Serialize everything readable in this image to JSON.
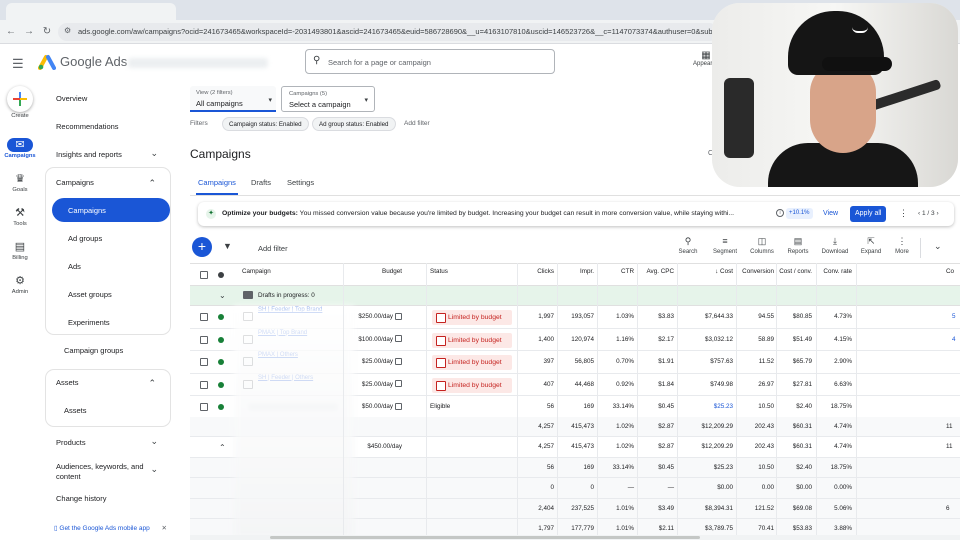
{
  "browser": {
    "url": "ads.google.com/aw/campaigns?ocid=241673465&workspaceId=-2031493801&ascid=241673465&euid=586728690&__u=4163107810&uscid=146523726&__c=1147073374&authuser=0&subid="
  },
  "header": {
    "brand": "Google Ads",
    "search_placeholder": "Search for a page or campaign",
    "appearance_label": "Appearan"
  },
  "rail": {
    "create": "Create",
    "campaigns": "Campaigns",
    "goals": "Goals",
    "tools": "Tools",
    "billing": "Billing",
    "admin": "Admin"
  },
  "nav": {
    "overview": "Overview",
    "recommendations": "Recommendations",
    "insights": "Insights and reports",
    "campaigns_group": "Campaigns",
    "campaigns_sub": [
      "Campaigns",
      "Ad groups",
      "Ads",
      "Asset groups",
      "Experiments",
      "Campaign groups"
    ],
    "assets_group": "Assets",
    "assets_sub": "Assets",
    "products": "Products",
    "audiences": "Audiences, keywords, and content",
    "change_history": "Change history",
    "mobile_app": "Get the Google Ads mobile app"
  },
  "selectors": {
    "view_caption": "View (2 filters)",
    "view_value": "All campaigns",
    "campaigns_caption": "Campaigns (5)",
    "campaigns_value": "Select a campaign"
  },
  "filters": {
    "label": "Filters",
    "chips": [
      "Campaign status: Enabled",
      "Ad group status: Enabled"
    ],
    "add": "Add filter"
  },
  "page": {
    "title": "Campaigns",
    "cu": "Cu",
    "tabs": [
      "Campaigns",
      "Drafts",
      "Settings"
    ]
  },
  "banner": {
    "bold": "Optimize your budgets:",
    "text": " You missed conversion value because you're limited by budget. Increasing your budget can result in more conversion value, while staying withi...",
    "pct": "+10.1%",
    "view": "View",
    "apply": "Apply all",
    "pager": "1 / 3"
  },
  "toolbar": {
    "add_filter": "Add filter",
    "tools": [
      "Search",
      "Segment",
      "Columns",
      "Reports",
      "Download",
      "Expand",
      "More"
    ]
  },
  "table": {
    "headers": [
      "Campaign",
      "Budget",
      "Status",
      "Clicks",
      "Impr.",
      "CTR",
      "Avg. CPC",
      "Cost",
      "Conversion",
      "Cost / conv.",
      "Conv. rate",
      "Co"
    ],
    "drafts": "Drafts in progress: 0",
    "rows": [
      {
        "name": "SH | Feeder | Top Brand",
        "budget": "$250.00/day",
        "status": "Limited by budget",
        "clicks": "1,997",
        "impr": "193,057",
        "ctr": "1.03%",
        "cpc": "$3.83",
        "cost": "$7,644.33",
        "conv": "94.55",
        "costconv": "$80.85",
        "convrate": "4.73%",
        "co": "5"
      },
      {
        "name": "PMAX | Top Brand",
        "budget": "$100.00/day",
        "status": "Limited by budget",
        "clicks": "1,400",
        "impr": "120,974",
        "ctr": "1.16%",
        "cpc": "$2.17",
        "cost": "$3,032.12",
        "conv": "58.89",
        "costconv": "$51.49",
        "convrate": "4.15%",
        "co": "4"
      },
      {
        "name": "PMAX | Others",
        "budget": "$25.00/day",
        "status": "Limited by budget",
        "clicks": "397",
        "impr": "56,805",
        "ctr": "0.70%",
        "cpc": "$1.91",
        "cost": "$757.63",
        "conv": "11.52",
        "costconv": "$65.79",
        "convrate": "2.90%",
        "co": ""
      },
      {
        "name": "SH | Feeder | Others",
        "budget": "$25.00/day",
        "status": "Limited by budget",
        "clicks": "407",
        "impr": "44,468",
        "ctr": "0.92%",
        "cpc": "$1.84",
        "cost": "$749.98",
        "conv": "26.97",
        "costconv": "$27.81",
        "convrate": "6.63%",
        "co": ""
      },
      {
        "name": "",
        "budget": "$50.00/day",
        "status": "Eligible",
        "clicks": "56",
        "impr": "169",
        "ctr": "33.14%",
        "cpc": "$0.45",
        "cost": "$25.23",
        "conv": "10.50",
        "costconv": "$2.40",
        "convrate": "18.75%",
        "co": ""
      }
    ],
    "summary": [
      {
        "budget": "",
        "clicks": "4,257",
        "impr": "415,473",
        "ctr": "1.02%",
        "cpc": "$2.87",
        "cost": "$12,209.29",
        "conv": "202.43",
        "costconv": "$60.31",
        "convrate": "4.74%",
        "co": "11"
      },
      {
        "budget": "$450.00/day",
        "clicks": "4,257",
        "impr": "415,473",
        "ctr": "1.02%",
        "cpc": "$2.87",
        "cost": "$12,209.29",
        "conv": "202.43",
        "costconv": "$60.31",
        "convrate": "4.74%",
        "co": "11"
      },
      {
        "budget": "",
        "clicks": "56",
        "impr": "169",
        "ctr": "33.14%",
        "cpc": "$0.45",
        "cost": "$25.23",
        "conv": "10.50",
        "costconv": "$2.40",
        "convrate": "18.75%",
        "co": ""
      },
      {
        "budget": "",
        "clicks": "0",
        "impr": "0",
        "ctr": "—",
        "cpc": "—",
        "cost": "$0.00",
        "conv": "0.00",
        "costconv": "$0.00",
        "convrate": "0.00%",
        "co": ""
      },
      {
        "budget": "",
        "clicks": "2,404",
        "impr": "237,525",
        "ctr": "1.01%",
        "cpc": "$3.49",
        "cost": "$8,394.31",
        "conv": "121.52",
        "costconv": "$69.08",
        "convrate": "5.06%",
        "co": "6"
      },
      {
        "budget": "",
        "clicks": "1,797",
        "impr": "177,779",
        "ctr": "1.01%",
        "cpc": "$2.11",
        "cost": "$3,789.75",
        "conv": "70.41",
        "costconv": "$53.83",
        "convrate": "3.88%",
        "co": ""
      }
    ]
  },
  "colors": {
    "primary": "#1a56d6",
    "draft_row": "#e6f4ea",
    "limited_bg": "#fce8e6",
    "limited_text": "#c5221f",
    "enabled_dot": "#188038"
  }
}
